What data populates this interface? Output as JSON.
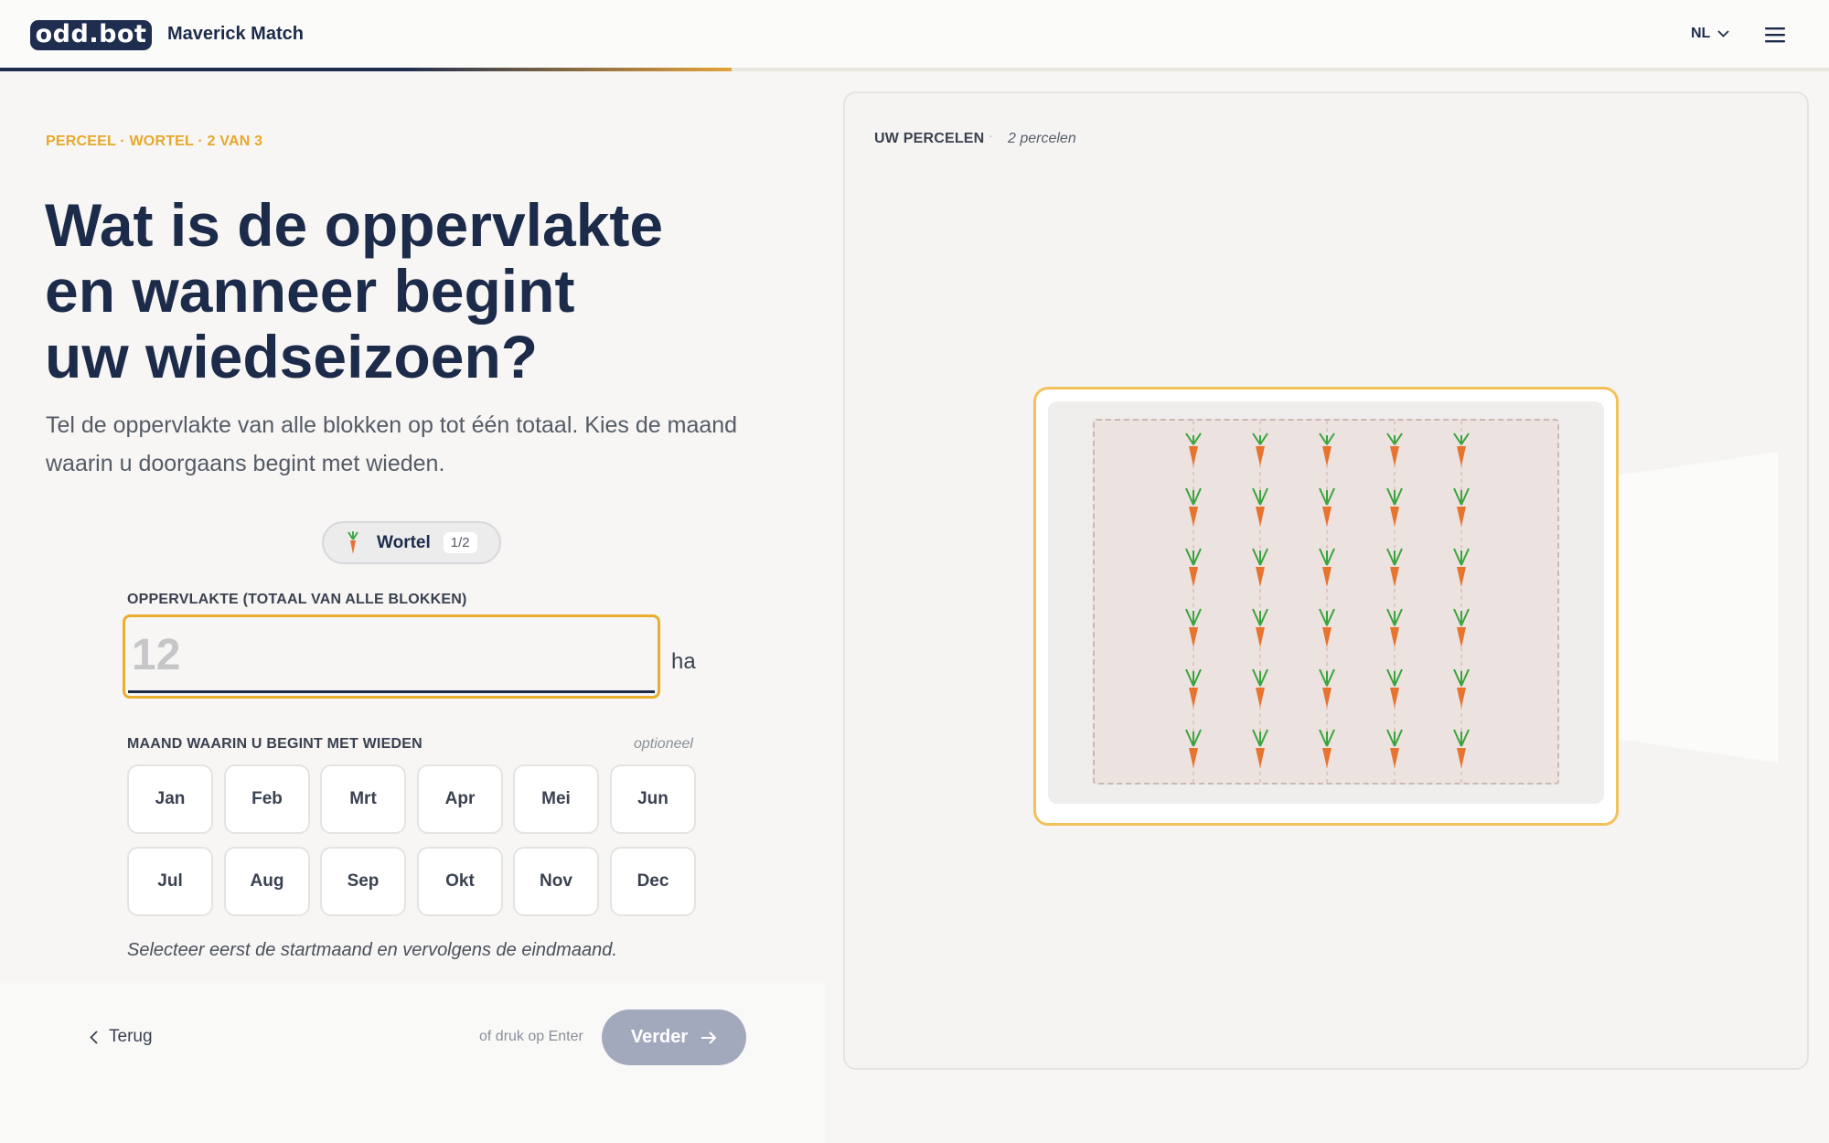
{
  "header": {
    "logo_text": "odd.bot",
    "app_name": "Maverick Match",
    "language": "NL",
    "progress": 0.4
  },
  "step": {
    "eyebrow": "PERCEEL · WORTEL · 2 VAN 3",
    "title": "Wat is de oppervlakte\nen wanneer begint\nuw wiedseizoen?",
    "subtitle": "Tel de oppervlakte van alle blokken op tot één totaal. Kies de maand waarin u doorgaans begint met wieden."
  },
  "crop_pill": {
    "name": "Wortel",
    "count": "1/2"
  },
  "area": {
    "label": "OPPERVLAKTE (TOTAAL VAN ALLE BLOKKEN)",
    "placeholder": "12",
    "value": "",
    "unit": "ha"
  },
  "months": {
    "label": "MAAND WAARIN U BEGINT MET WIEDEN",
    "optional": "optioneel",
    "items": [
      "Jan",
      "Feb",
      "Mrt",
      "Apr",
      "Mei",
      "Jun",
      "Jul",
      "Aug",
      "Sep",
      "Okt",
      "Nov",
      "Dec"
    ],
    "hint": "Selecteer eerst de startmaand en vervolgens de eindmaand."
  },
  "footer": {
    "back_label": "Terug",
    "enter_hint": "of druk op Enter",
    "next_label": "Verder"
  },
  "plots_panel": {
    "title": "UW PERCELEN",
    "separator": "·",
    "count": "2 percelen"
  },
  "colors": {
    "navy": "#1f2d4e",
    "accent": "#e9ad2f",
    "carrot": "#e8732e",
    "leaf": "#3aa33d"
  }
}
